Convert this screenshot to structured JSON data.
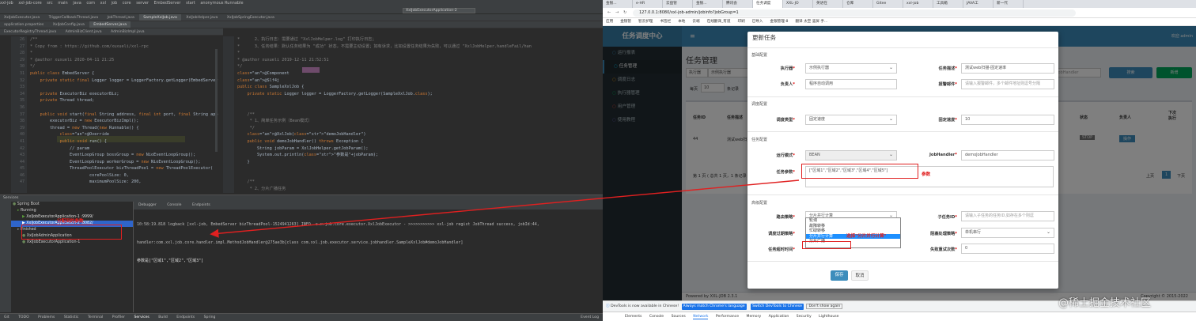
{
  "ide": {
    "menu": [
      "xxl-job",
      "xxl-job-core",
      "src",
      "main",
      "java",
      "com",
      "xxl",
      "job",
      "core",
      "server",
      "EmbedServer",
      "start",
      "anonymous Runnable"
    ],
    "run_config": "XxlJobExecutorApplication-2",
    "tabs_row1": [
      "XxlJobExecutor.java",
      "TriggerCallbackThread.java",
      "JobThread.java",
      "SampleXxlJob.java",
      "XxlJobHelper.java",
      "XxlJobSpringExecutor.java"
    ],
    "tabs_row2": [
      "application.properties",
      "XxlJobConfig.java",
      "EmbedServer.java"
    ],
    "tabs_row3": [
      "ExecutorRegistryThread.java",
      "AdminBizClient.java",
      "AdminBizImpl.java"
    ],
    "left_lines": [
      "26",
      "27",
      "28",
      "29",
      "30",
      "31",
      "32",
      "33",
      "34",
      "35",
      "36",
      "37",
      "38",
      "39",
      "40",
      "41",
      "42",
      "43",
      "44",
      "45",
      "46",
      "47"
    ],
    "right_lines": [
      "",
      "",
      "",
      "",
      "",
      "",
      "",
      "",
      "",
      "",
      "",
      "",
      "",
      "",
      "",
      "",
      "",
      "",
      "",
      "",
      "",
      ""
    ],
    "left_code": [
      "/**",
      "* Copy from : https://github.com/xuxueli/xxl-rpc",
      "*",
      "* @author xuxueli 2020-04-11 21:25",
      "*/",
      "public class EmbedServer {",
      "    private static final Logger logger = LoggerFactory.getLogger(EmbedServer.class);",
      "",
      "    private ExecutorBiz executorBiz;",
      "    private Thread thread;",
      "",
      "    public void start(final String address, final int port, final String appname, final",
      "        executorBiz = new ExecutorBizImpl();",
      "        thread = new Thread(new Runnable() {",
      "            @Override",
      "            public void run() {",
      "                // param",
      "                EventLoopGroup bossGroup = new NioEventLoopGroup();",
      "                EventLoopGroup workerGroup = new NioEventLoopGroup();",
      "                ThreadPoolExecutor bizThreadPool = new ThreadPoolExecutor(",
      "                        corePoolSize: 0,",
      "                        maximumPoolSize: 200,"
    ],
    "right_code": [
      "*      2、执行日志：需要通过 \"XxlJobHelper.log\" 打印执行日志；",
      "*      3、任务结果：默认任务结果为 \"成功\" 状态，不需要主动设置；如有诉求，比如设置任务结果为失败，可以通过 \"XxlJobHelper.handleFail/han",
      "*",
      "* @author xuxueli 2019-12-11 21:52:51",
      "*/",
      "@Component",
      "@Slf4j",
      "public class SampleXxlJob {",
      "    private static Logger logger = LoggerFactory.getLogger(SampleXxlJob.class);",
      "",
      "",
      "    /**",
      "     * 1、简单任务示例（Bean模式）",
      "     */",
      "    @XxlJob(\"demoJobHandler\")",
      "    public void demoJobHandler() throws Exception {",
      "        String jobParam = XxlJobHelper.getJobParam();",
      "        System.out.println(\"参数是\"+jobParam);",
      "    }",
      "",
      "",
      "    /**"
    ],
    "right_code_tail": [
      "     * 2、分片广播任务",
      "     */",
      "    @XxlJob(\"shardingJobHandler\")",
      "    public void shardingJobHandler() throws Exception {"
    ],
    "services_title": "Services",
    "tree": [
      "Spring Boot",
      "Running",
      "XxlJobExecutorApplication-1 :9999/",
      "XxlJobExecutorApplication-2 :8082/",
      "Finished",
      "XxlJobAdminApplication",
      "XxlJobExecutorApplication-1"
    ],
    "console_tabs": [
      "Debugger",
      "Console",
      "Endpoints"
    ],
    "log": [
      "10:58:19.818 logback [xxl-job, EmbedServer bizThreadPool-1524941263] INFO  c.x.job.core.executor.XxlJobExecutor - >>>>>>>>>>> xxl-job regist JobThread success, jobId:44,",
      "handler:com.xxl.job.core.handler.impl.MethodJobHandler@275ae3b[class com.xxl.job.executor.service.jobhandler.SampleXxlJob#demoJobHandler]",
      "参数是[\"区域1\",\"区域2\",\"区域3\"]"
    ],
    "anno_param": "分配到的参数",
    "status": [
      "Git",
      "TODO",
      "Problems",
      "Statistic",
      "Terminal",
      "Profiler",
      "Services",
      "Build",
      "Endpoints",
      "Spring"
    ],
    "status_right": "Event Log"
  },
  "browser": {
    "tabs": [
      "金银...",
      "e-HR",
      "云盘管",
      "金银...",
      "腾讯会",
      "任务调度",
      "XXL-JO",
      "英语在",
      "仓库",
      "Gitee",
      "xxl-job",
      "工具箱",
      "JAVA工",
      "新一代"
    ],
    "url": "127.0.0.1:8080/xxl-job-admin/jobinfo?jobGroup=1",
    "bookmarks": [
      "应用",
      "金银管",
      "智云护理",
      "书签栏",
      "本地",
      "云端",
      "在线翻译_有道",
      "印刷",
      "已导入",
      "金银管理-8",
      "翻译 太空 竖屏 手..."
    ],
    "logo": "任务调度中心",
    "welcome": "欢迎 admin",
    "menu": [
      "运行报表",
      "任务管理",
      "调度日志",
      "执行器管理",
      "用户管理",
      "使用教程"
    ],
    "page_title": "任务管理",
    "bg": {
      "executor": "执行器",
      "exec_val": "示例执行器",
      "search_ph": "JobHandler",
      "search_btn": "搜索",
      "add_btn": "新增",
      "per_page": "每页",
      "per_page_n": "10",
      "records": "条记录",
      "col_id": "任务ID",
      "col_desc": "任务描述",
      "col_status": "状态",
      "col_owner": "负责人",
      "col_next": "下次执行",
      "row_id": "44",
      "row_desc": "测试web扫描-",
      "row_status": "STOP",
      "row_op": "操作",
      "info": "第 1 页 ( 总共 1 页，1 条记录 )",
      "prev": "上页",
      "page": "1",
      "next": "下页",
      "footer": "Powered by XXL-JOB 2.3.1",
      "copyright": "Copyright © 2015-2022"
    },
    "modal": {
      "title": "更新任务",
      "s_basic": "基础配置",
      "l_exec": "执行器",
      "v_exec": "示例执行器",
      "l_desc": "任务描述",
      "v_desc": "测试web扫描-固定速率",
      "l_owner": "负责人",
      "v_owner": "程序自动调用",
      "l_alarm": "报警邮件",
      "ph_alarm": "请输入报警邮件，多个邮件地址则逗号分隔",
      "s_sched": "调度配置",
      "l_type": "调度类型",
      "v_type": "固定速度",
      "l_speed": "固定速度",
      "v_speed": "10",
      "s_task": "任务配置",
      "l_mode": "运行模式",
      "v_mode": "BEAN",
      "l_handler": "JobHandler",
      "v_handler": "demoJobHandler",
      "l_param": "任务参数",
      "v_param": "[\"区域1\",\"区域2\",\"区域3\",\"区域4\",\"区域5\"]",
      "s_adv": "高级配置",
      "l_route": "路由策略",
      "v_route": "分片并行计算",
      "l_child": "子任务ID",
      "ph_child": "请输入子任务的任务ID,如存在多个则逗",
      "l_expire": "调度过期策略",
      "l_block": "阻塞处理策略",
      "v_block": "单机串行",
      "l_timeout": "任务超时时间",
      "l_retry": "失败重试次数",
      "v_retry": "0",
      "dropdown": [
        "轮询",
        "故障转移",
        "忙碌转移",
        "分片并行计算",
        "分片广播"
      ],
      "save": "保存",
      "cancel": "取消"
    },
    "anno_param": "参数",
    "anno_route": "选择\"分片并行计算\"",
    "devtools_msg": "DevTools is now available in Chinese!",
    "dev_btn1": "Always match Chrome's language",
    "dev_btn2": "Switch DevTools to Chinese",
    "dev_btn3": "Don't show again",
    "devtabs": [
      "Elements",
      "Console",
      "Sources",
      "Network",
      "Performance",
      "Memory",
      "Application",
      "Security",
      "Lighthouse"
    ]
  },
  "watermark": "@稀土掘金技术社区",
  "colors": {
    "accent": "#3c8dbc",
    "sidebar": "#222d32",
    "annotation": "#e02020"
  }
}
